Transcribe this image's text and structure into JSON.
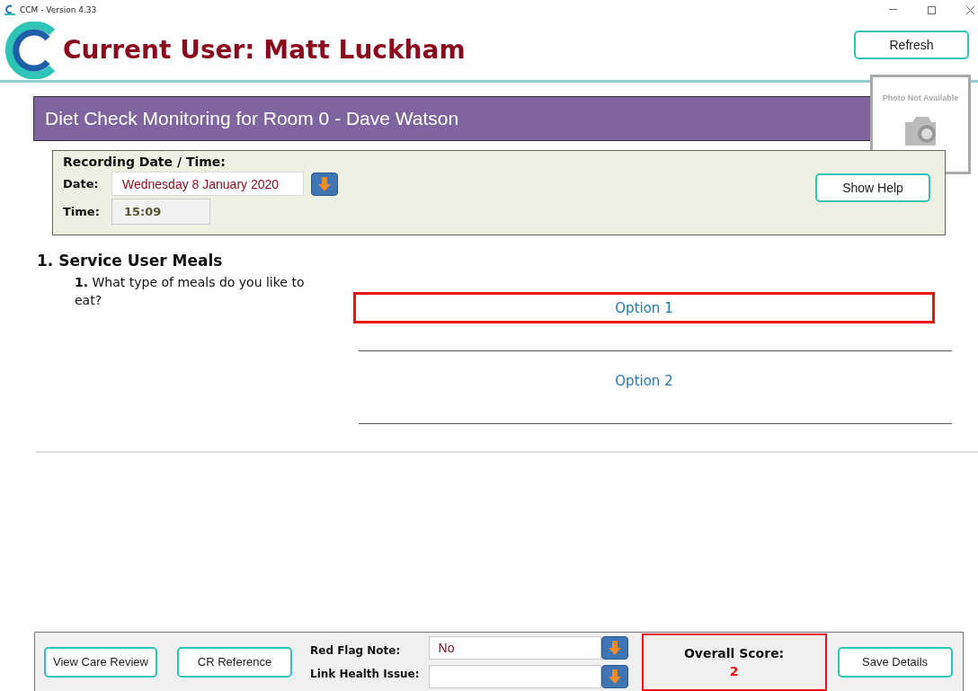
{
  "window": {
    "title": "CCM - Version 4.33"
  },
  "header": {
    "title": "Current User: Matt Luckham",
    "refresh_button": "Refresh",
    "photo_caption": "Photo Not Available"
  },
  "banner": {
    "title": "Diet Check Monitoring for Room 0 - Dave Watson"
  },
  "recording": {
    "heading": "Recording Date / Time:",
    "date_label": "Date:",
    "date_value": "Wednesday 8 January 2020",
    "time_label": "Time:",
    "time_value": "15:09",
    "help_button": "Show Help"
  },
  "section": {
    "title": "1. Service User Meals",
    "questions": [
      {
        "number": "1.",
        "text": "What type of meals do you like to eat?",
        "options": [
          {
            "label": "Option 1",
            "selected": true
          },
          {
            "label": "Option 2",
            "selected": false
          }
        ]
      }
    ]
  },
  "footer": {
    "view_care_review": "View Care Review",
    "cr_reference": "CR Reference",
    "red_flag_label": "Red Flag Note:",
    "red_flag_value": "No",
    "link_health_label": "Link Health Issue:",
    "score_label": "Overall Score:",
    "score_value": "2",
    "save_button": "Save Details"
  }
}
